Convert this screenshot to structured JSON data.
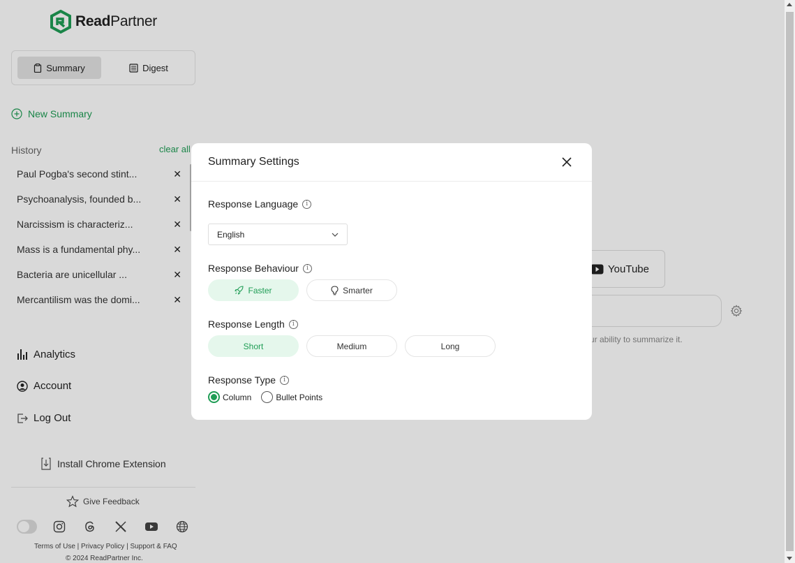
{
  "brand": {
    "bold": "Read",
    "light": "Partner",
    "accent": "#1f9d55"
  },
  "sidebar": {
    "modes": [
      {
        "label": "Summary",
        "icon": "clipboard-icon",
        "active": true
      },
      {
        "label": "Digest",
        "icon": "newspaper-icon",
        "active": false
      }
    ],
    "new_summary": "New Summary",
    "history_label": "History",
    "clear_all": "clear all",
    "history": [
      "Paul Pogba's second stint...",
      "Psychoanalysis, founded b...",
      "Narcissism is characteriz...",
      "Mass is a fundamental phy...",
      "Bacteria are unicellular ...",
      "Mercantilism was the domi..."
    ],
    "nav": {
      "analytics": "Analytics",
      "account": "Account",
      "logout": "Log Out"
    },
    "install": "Install Chrome Extension",
    "feedback": "Give Feedback",
    "footer_links": "Terms of Use | Privacy Policy | Support & FAQ",
    "copyright": "© 2024 ReadPartner Inc."
  },
  "main": {
    "youtube_label": "YouTube",
    "hint": "ur ability to summarize it."
  },
  "modal": {
    "title": "Summary Settings",
    "language_label": "Response Language",
    "language_value": "English",
    "behaviour_label": "Response Behaviour",
    "behaviour_options": [
      "Faster",
      "Smarter"
    ],
    "behaviour_selected": "Faster",
    "length_label": "Response Length",
    "length_options": [
      "Short",
      "Medium",
      "Long"
    ],
    "length_selected": "Short",
    "type_label": "Response Type",
    "type_options": [
      "Column",
      "Bullet Points"
    ],
    "type_selected": "Column"
  }
}
